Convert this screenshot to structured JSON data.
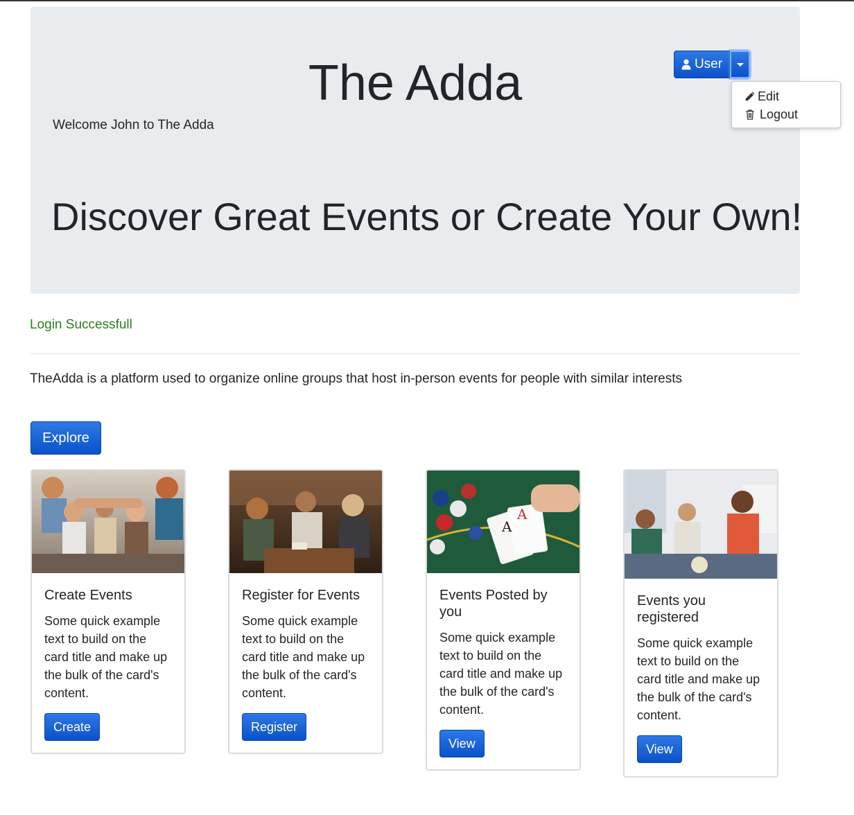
{
  "header": {
    "title": "The Adda",
    "welcome": "Welcome John to The Adda",
    "tagline": "Discover Great Events or Create Your Own!"
  },
  "user_menu": {
    "button_label": "User",
    "icon": "user-icon",
    "items": [
      {
        "label": "Edit",
        "icon": "pencil-icon"
      },
      {
        "label": "Logout",
        "icon": "trash-icon"
      }
    ]
  },
  "status": {
    "message": "Login Successfull"
  },
  "about": {
    "text": "TheAdda is a platform used to organize online groups that host in-person events for people with similar interests"
  },
  "explore": {
    "label": "Explore"
  },
  "cards": [
    {
      "title": "Create Events",
      "text": "Some quick example text to build on the card title and make up the bulk of the card's content.",
      "button": "Create"
    },
    {
      "title": "Register for Events",
      "text": "Some quick example text to build on the card title and make up the bulk of the card's content.",
      "button": "Register"
    },
    {
      "title": "Events Posted by you",
      "text": "Some quick example text to build on the card title and make up the bulk of the card's content.",
      "button": "View"
    },
    {
      "title": "Events you registered",
      "text": "Some quick example text to build on the card title and make up the bulk of the card's content.",
      "button": "View"
    }
  ],
  "colors": {
    "primary": "#0a52c9",
    "jumbotron_bg": "#e9ecef",
    "success_text": "#2e7d1f"
  }
}
